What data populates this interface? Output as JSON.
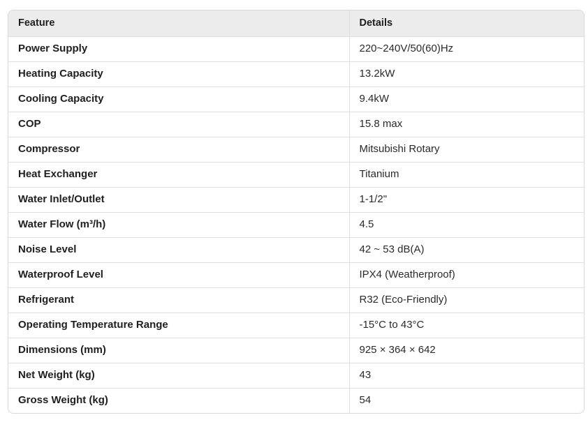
{
  "table": {
    "headers": [
      "Feature",
      "Details"
    ],
    "rows": [
      {
        "feature": "Power Supply",
        "details": "220~240V/50(60)Hz"
      },
      {
        "feature": "Heating Capacity",
        "details": "13.2kW"
      },
      {
        "feature": "Cooling Capacity",
        "details": "9.4kW"
      },
      {
        "feature": "COP",
        "details": "15.8 max"
      },
      {
        "feature": "Compressor",
        "details": "Mitsubishi Rotary"
      },
      {
        "feature": "Heat Exchanger",
        "details": "Titanium"
      },
      {
        "feature": "Water Inlet/Outlet",
        "details": "1-1/2\""
      },
      {
        "feature": "Water Flow (m³/h)",
        "details": "4.5"
      },
      {
        "feature": "Noise Level",
        "details": "42 ~ 53 dB(A)"
      },
      {
        "feature": "Waterproof Level",
        "details": "IPX4 (Weatherproof)"
      },
      {
        "feature": "Refrigerant",
        "details": "R32 (Eco-Friendly)"
      },
      {
        "feature": "Operating Temperature Range",
        "details": "-15°C to 43°C"
      },
      {
        "feature": "Dimensions (mm)",
        "details": "925 × 364 × 642"
      },
      {
        "feature": "Net Weight (kg)",
        "details": "43"
      },
      {
        "feature": "Gross Weight (kg)",
        "details": "54"
      }
    ]
  },
  "colors": {
    "header_background": "#ececec",
    "border": "#dedede",
    "text": "#1f1f1f"
  }
}
